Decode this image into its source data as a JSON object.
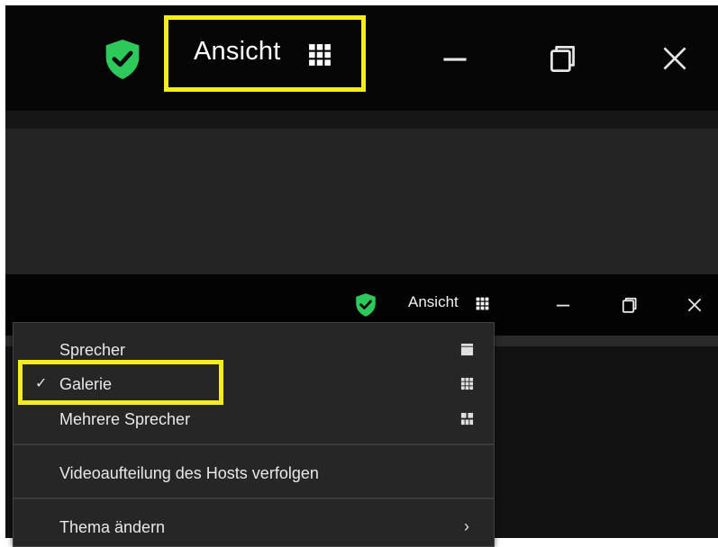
{
  "top_titlebar": {
    "view_label": "Ansicht",
    "icons": [
      "shield-check-icon",
      "grid-icon",
      "minimize-icon",
      "restore-icon",
      "close-icon"
    ],
    "highlight_color": "#f4ec1c"
  },
  "bottom_titlebar": {
    "view_label": "Ansicht",
    "icons": [
      "shield-check-icon",
      "grid-icon",
      "minimize-icon",
      "restore-icon",
      "close-icon"
    ]
  },
  "view_menu": {
    "items": [
      {
        "label": "Sprecher",
        "checked": false,
        "icon": "speaker-view-icon"
      },
      {
        "label": "Galerie",
        "checked": true,
        "icon": "gallery-grid-icon"
      },
      {
        "label": "Mehrere Sprecher",
        "checked": false,
        "icon": "multi-speaker-icon"
      },
      {
        "label": "Videoaufteilung des Hosts verfolgen"
      },
      {
        "label": "Thema ändern",
        "icon": "chevron-right-icon"
      }
    ],
    "check_mark": "✓",
    "submenu_mark": "›"
  },
  "colors": {
    "shield_green": "#2ec95b",
    "highlight_yellow": "#f4ec1c",
    "titlebar_bg": "#050505",
    "menu_bg": "#262626"
  }
}
